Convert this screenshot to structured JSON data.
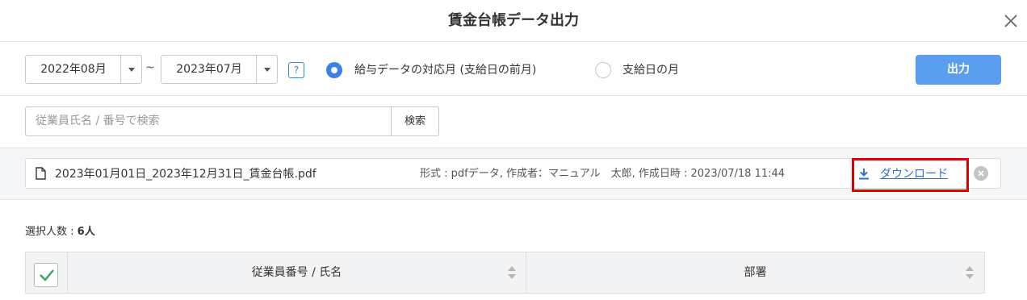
{
  "dialog": {
    "title": "賃金台帳データ出力",
    "close_icon": "close-icon"
  },
  "filters": {
    "start_month": "2022年08月",
    "end_month": "2023年07月",
    "range_separator": "~",
    "help_label": "?",
    "radio_options": [
      {
        "label": "給与データの対応月 (支給日の前月)",
        "selected": true
      },
      {
        "label": "支給日の月",
        "selected": false
      }
    ],
    "output_button": "出力"
  },
  "search": {
    "placeholder": "従業員氏名 / 番号で検索",
    "button": "検索"
  },
  "file": {
    "name": "2023年01月01日_2023年12月31日_賃金台帳.pdf",
    "meta": "形式 : pdfデータ, 作成者：マニュアル　太郎, 作成日時 : 2023/07/18 11:44",
    "download_label": "ダウンロード",
    "icons": [
      "file-icon",
      "download-icon",
      "remove-icon"
    ]
  },
  "selection": {
    "label": "選択人数 : ",
    "count": "6人"
  },
  "table": {
    "columns": [
      "従業員番号 / 氏名",
      "部署"
    ],
    "all_checked": true
  },
  "colors": {
    "accent": "#3b82e6",
    "output_button": "#5a9ef0",
    "highlight_box": "#e00000",
    "link": "#2f6fd0"
  }
}
